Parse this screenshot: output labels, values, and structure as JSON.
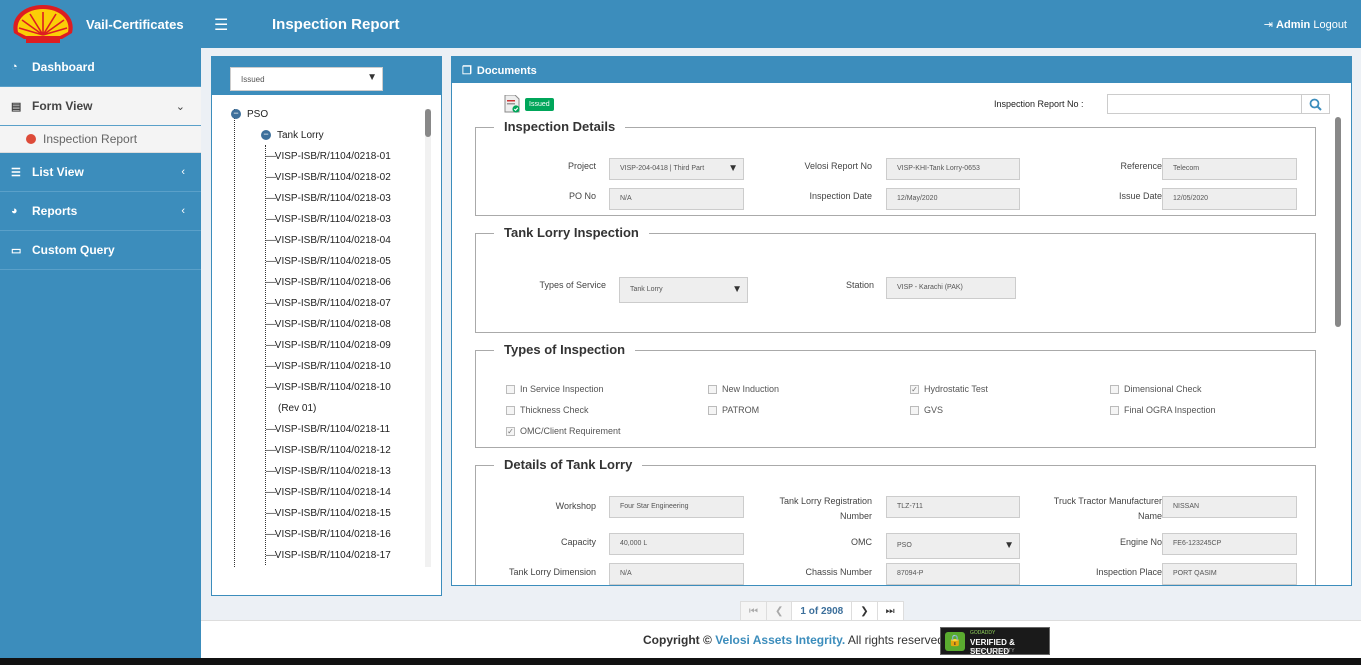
{
  "header": {
    "brand": "Vail-Certificates",
    "title": "Inspection Report",
    "user": "Admin",
    "logout": "Logout"
  },
  "sidebar": {
    "items": [
      {
        "label": "Dashboard",
        "icon": "dashboard-icon"
      },
      {
        "label": "Form View",
        "icon": "form-icon"
      },
      {
        "label": "Inspection Report",
        "icon": "dot-icon"
      },
      {
        "label": "List View",
        "icon": "list-icon"
      },
      {
        "label": "Reports",
        "icon": "pie-chart-icon"
      },
      {
        "label": "Custom Query",
        "icon": "laptop-icon"
      }
    ]
  },
  "tree": {
    "filter_value": "Issued",
    "root": "PSO",
    "child": "Tank Lorry",
    "leaves": [
      "VISP-ISB/R/1104/0218-01",
      "VISP-ISB/R/1104/0218-02",
      "VISP-ISB/R/1104/0218-03",
      "VISP-ISB/R/1104/0218-03",
      "VISP-ISB/R/1104/0218-04",
      "VISP-ISB/R/1104/0218-05",
      "VISP-ISB/R/1104/0218-06",
      "VISP-ISB/R/1104/0218-07",
      "VISP-ISB/R/1104/0218-08",
      "VISP-ISB/R/1104/0218-09",
      "VISP-ISB/R/1104/0218-10",
      "VISP-ISB/R/1104/0218-10",
      "(Rev 01)",
      "VISP-ISB/R/1104/0218-11",
      "VISP-ISB/R/1104/0218-12",
      "VISP-ISB/R/1104/0218-13",
      "VISP-ISB/R/1104/0218-14",
      "VISP-ISB/R/1104/0218-15",
      "VISP-ISB/R/1104/0218-16",
      "VISP-ISB/R/1104/0218-17"
    ]
  },
  "documents": {
    "title": "Documents",
    "status_badge": "Issued",
    "report_no_label": "Inspection Report No :",
    "report_no_value": ""
  },
  "inspection_details": {
    "title": "Inspection Details",
    "project_label": "Project",
    "project_value": "VISP-204-0418 | Third Part",
    "velosi_label": "Velosi Report No",
    "velosi_value": "VISP-KHI-Tank Lorry-0653",
    "reference_label": "Reference",
    "reference_value": "Telecom",
    "po_label": "PO No",
    "po_value": "N/A",
    "inspection_date_label": "Inspection Date",
    "inspection_date_value": "12/May/2020",
    "issue_date_label": "Issue Date",
    "issue_date_value": "12/05/2020"
  },
  "tank_lorry_inspection": {
    "title": "Tank Lorry Inspection",
    "service_label": "Types of Service",
    "service_value": "Tank Lorry",
    "station_label": "Station",
    "station_value": "VISP - Karachi (PAK)"
  },
  "types_of_inspection": {
    "title": "Types of Inspection",
    "options": [
      {
        "label": "In Service Inspection",
        "checked": false
      },
      {
        "label": "New Induction",
        "checked": false
      },
      {
        "label": "Hydrostatic Test",
        "checked": true
      },
      {
        "label": "Dimensional Check",
        "checked": false
      },
      {
        "label": "Thickness Check",
        "checked": false
      },
      {
        "label": "PATROM",
        "checked": false
      },
      {
        "label": "GVS",
        "checked": false
      },
      {
        "label": "Final OGRA Inspection",
        "checked": false
      },
      {
        "label": "OMC/Client Requirement",
        "checked": true
      }
    ]
  },
  "details_tank_lorry": {
    "title": "Details of Tank Lorry",
    "workshop_label": "Workshop",
    "workshop_value": "Four Star Engineering",
    "registration_label": "Tank Lorry Registration Number",
    "registration_value": "TLZ-711",
    "truck_label": "Truck Tractor Manufacturer Name",
    "truck_value": "NISSAN",
    "capacity_label": "Capacity",
    "capacity_value": "40,000 L",
    "omc_label": "OMC",
    "omc_value": "PSO",
    "engine_label": "Engine No",
    "engine_value": "FE6-123245CP",
    "dimension_label": "Tank Lorry Dimension",
    "dimension_value": "N/A",
    "chassis_label": "Chassis Number",
    "chassis_value": "87094-P",
    "place_label": "Inspection Place",
    "place_value": "PORT QASIM"
  },
  "pager": {
    "current": "1 of 2908"
  },
  "footer": {
    "copyright": "Copyright ©",
    "company": "Velosi Assets Integrity.",
    "rights": "All rights reserved.",
    "badge_top": "GODADDY",
    "badge_main": "VERIFIED & SECURED",
    "badge_sub": "VERIFY SECURITY"
  },
  "colors": {
    "primary": "#3c8dbc",
    "success": "#00a65a",
    "danger": "#dd4b39"
  }
}
